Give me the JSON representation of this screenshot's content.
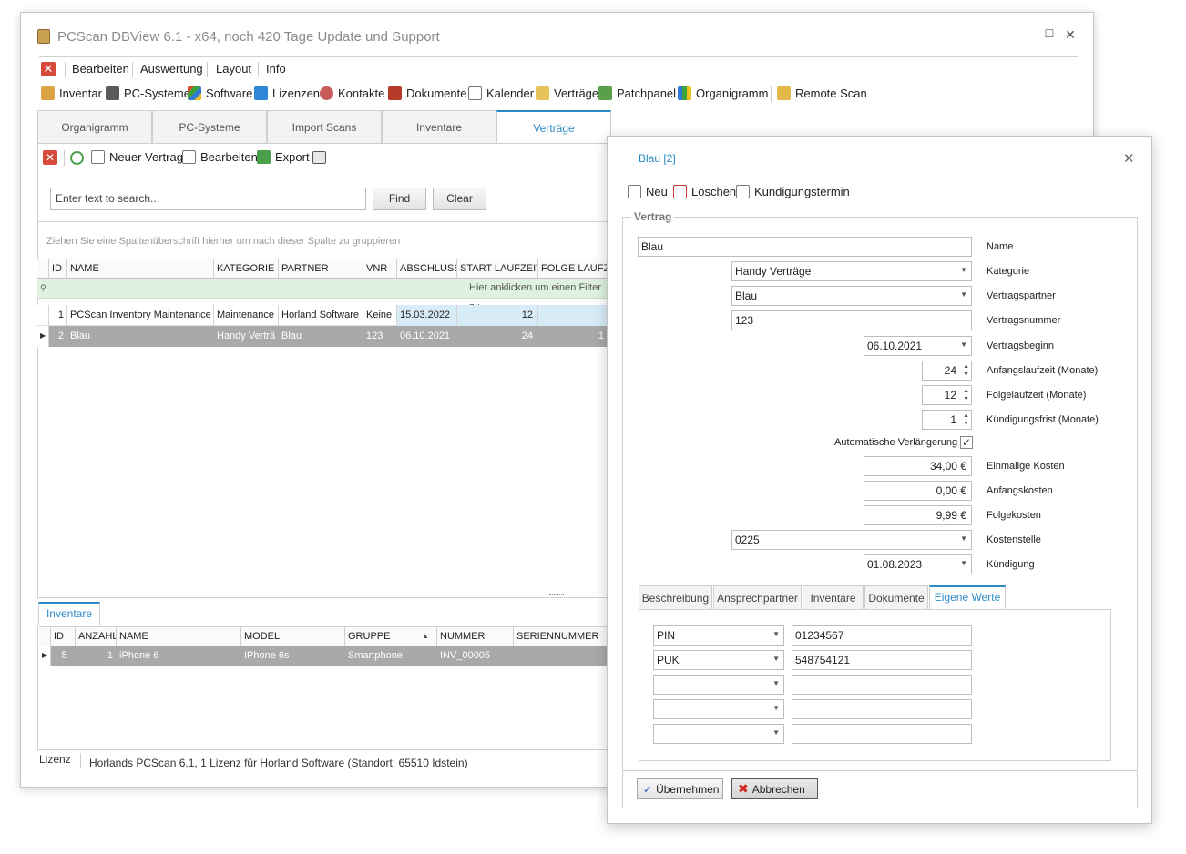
{
  "window": {
    "title": "PCScan DBView 6.1 - x64, noch 420 Tage Update und Support",
    "minimize": "–",
    "maximize": "☐",
    "close": "✕"
  },
  "menu": {
    "close_glyph": "✕",
    "items": [
      "Bearbeiten",
      "Auswertung",
      "Layout",
      "Info"
    ]
  },
  "toolbar": {
    "items": [
      "Inventar",
      "PC-Systeme",
      "Software",
      "Lizenzen",
      "Kontakte",
      "Dokumente",
      "Kalender",
      "Verträge",
      "Patchpanel",
      "Organigramm",
      "Remote Scan"
    ]
  },
  "tabs": [
    "Organigramm",
    "PC-Systeme",
    "Import Scans",
    "Inventare",
    "Verträge"
  ],
  "sub_toolbar": {
    "new_contract": "Neuer Vertrag",
    "edit": "Bearbeiten",
    "export": "Export"
  },
  "search": {
    "placeholder": "Enter text to search...",
    "find": "Find",
    "clear": "Clear"
  },
  "grid": {
    "group_hint": "Ziehen Sie eine Spaltenüberschrift hierher um nach dieser Spalte zu gruppieren",
    "columns": [
      "ID",
      "NAME",
      "KATEGORIE",
      "PARTNER",
      "VNR",
      "ABSCHLUSS",
      "START LAUFZEIT",
      "FOLGE LAUFZE"
    ],
    "filter_hint": "Hier anklicken um einen Filter zu",
    "rows": [
      {
        "id": "1",
        "name": "PCScan Inventory Maintenance",
        "kategorie": "Maintenance",
        "partner": "Horland Software",
        "vnr": "Keine",
        "abschluss": "15.03.2022",
        "start": "12",
        "folge": ""
      },
      {
        "id": "2",
        "name": "Blau",
        "kategorie": "Handy Verträ",
        "partner": "Blau",
        "vnr": "123",
        "abschluss": "06.10.2021",
        "start": "24",
        "folge": "1"
      }
    ]
  },
  "bottom": {
    "tab": "Inventare",
    "columns": [
      "ID",
      "ANZAHL",
      "NAME",
      "MODEL",
      "GRUPPE",
      "NUMMER",
      "SERIENNUMMER"
    ],
    "sort_glyph": "▲",
    "row": {
      "id": "5",
      "anzahl": "1",
      "name": "iPhone 6",
      "model": "IPhone 6s",
      "gruppe": "Smartphone",
      "nummer": "INV_00005",
      "serien": ""
    }
  },
  "status": {
    "label": "Lizenz",
    "text": "Horlands PCScan 6.1, 1 Lizenz für Horland Software (Standort: 65510 Idstein)"
  },
  "dialog": {
    "title": "Blau [2]",
    "close": "✕",
    "toolbar": {
      "new": "Neu",
      "delete": "Löschen",
      "termination_date": "Kündigungstermin"
    },
    "legend": "Vertrag",
    "fields": {
      "name": {
        "value": "Blau",
        "label": "Name"
      },
      "kategorie": {
        "value": "Handy Verträge",
        "label": "Kategorie"
      },
      "partner": {
        "value": "Blau",
        "label": "Vertragspartner"
      },
      "nummer": {
        "value": "123",
        "label": "Vertragsnummer"
      },
      "beginn": {
        "value": "06.10.2021",
        "label": "Vertragsbeginn"
      },
      "anfang": {
        "value": "24",
        "label": "Anfangslaufzeit (Monate)"
      },
      "folge": {
        "value": "12",
        "label": "Folgelaufzeit (Monate)"
      },
      "frist": {
        "value": "1",
        "label": "Kündigungsfrist (Monate)"
      },
      "auto": {
        "label": "Automatische Verlängerung",
        "checked": true,
        "glyph": "✓"
      },
      "einmalig": {
        "value": "34,00 €",
        "label": "Einmalige Kosten"
      },
      "anfangskosten": {
        "value": "0,00 €",
        "label": "Anfangskosten"
      },
      "folgekosten": {
        "value": "9,99 €",
        "label": "Folgekosten"
      },
      "kostenstelle": {
        "value": "0225",
        "label": "Kostenstelle"
      },
      "kuendigung": {
        "value": "01.08.2023",
        "label": "Kündigung"
      }
    },
    "tabs": [
      "Beschreibung",
      "Ansprechpartner",
      "Inventare",
      "Dokumente",
      "Eigene Werte"
    ],
    "custom_values": [
      {
        "key": "PIN",
        "value": "01234567"
      },
      {
        "key": "PUK",
        "value": "548754121"
      },
      {
        "key": "",
        "value": ""
      },
      {
        "key": "",
        "value": ""
      },
      {
        "key": "",
        "value": ""
      }
    ],
    "buttons": {
      "apply": "Übernehmen",
      "cancel": "Abbrechen"
    }
  }
}
